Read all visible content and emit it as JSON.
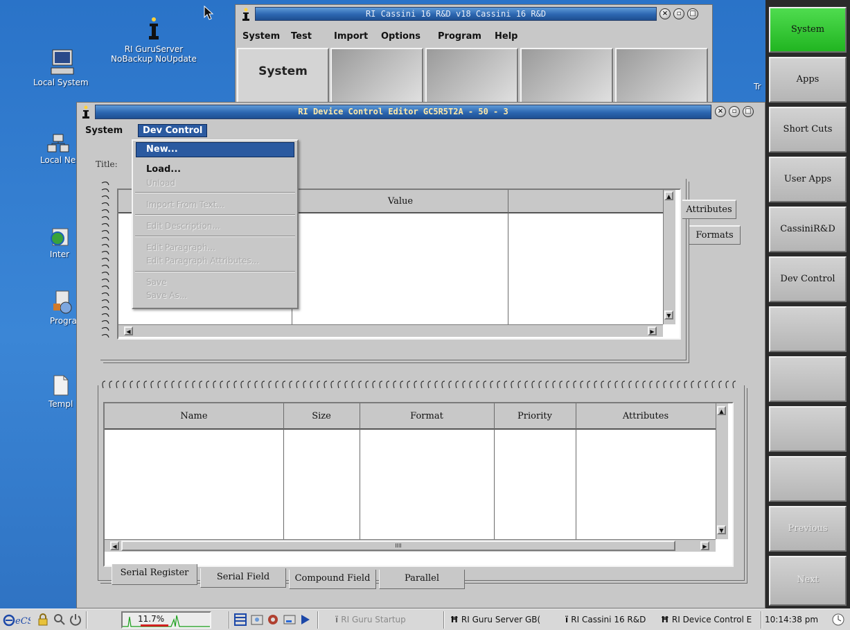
{
  "desktop": {
    "icons": [
      {
        "label": "Local System",
        "icon": "computer-icon"
      },
      {
        "label": "RI GuruServer",
        "label2": "NoBackup NoUpdate",
        "icon": "ri-server-icon"
      },
      {
        "label": "Local Ne",
        "icon": "network-icon"
      },
      {
        "label": "Inter",
        "icon": "internet-icon"
      },
      {
        "label": "Progra",
        "icon": "programs-icon"
      },
      {
        "label": "Templ",
        "icon": "template-icon"
      },
      {
        "label": "Tr",
        "icon": "trash-icon"
      }
    ]
  },
  "cassini_window": {
    "title": "RI Cassini 16 R&D v18  Cassini 16 R&D",
    "menu": [
      "System",
      "Test",
      "Import",
      "Options",
      "Program",
      "Help"
    ],
    "tabs": [
      "System",
      "",
      "",
      "",
      ""
    ]
  },
  "editor_window": {
    "title": "RI Device Control Editor GC5R5T2A - 50 - 3",
    "menu": [
      "System",
      "Dev Control"
    ],
    "title_label": "Title:",
    "upper_table": {
      "columns": [
        "",
        "Value",
        ""
      ],
      "side_tabs": [
        "Attributes",
        "Formats"
      ]
    },
    "lower_table": {
      "columns": [
        "Name",
        "Size",
        "Format",
        "Priority",
        "Attributes"
      ],
      "scroll_grip": "IIII"
    },
    "bottom_tabs": [
      "Serial Register",
      "Serial Field",
      "Compound Field",
      "Parallel"
    ]
  },
  "dev_control_menu": {
    "items": [
      {
        "label": "New...",
        "state": "highlighted"
      },
      {
        "label": "Load...",
        "state": "enabled"
      },
      {
        "label": "Unload",
        "state": "disabled"
      },
      {
        "label": "Import From Text...",
        "state": "disabled"
      },
      {
        "label": "Edit Description...",
        "state": "disabled"
      },
      {
        "label": "Edit Paragraph...",
        "state": "disabled"
      },
      {
        "label": "Edit Paragraph Attributes...",
        "state": "disabled"
      },
      {
        "label": "Save",
        "state": "disabled"
      },
      {
        "label": "Save As...",
        "state": "disabled"
      }
    ]
  },
  "right_panel": {
    "buttons": [
      {
        "label": "System",
        "state": "active"
      },
      {
        "label": "Apps",
        "state": "normal"
      },
      {
        "label": "Short Cuts",
        "state": "normal"
      },
      {
        "label": "User Apps",
        "state": "normal"
      },
      {
        "label": "CassiniR&D",
        "state": "normal"
      },
      {
        "label": "Dev Control",
        "state": "normal"
      },
      {
        "label": "",
        "state": "normal"
      },
      {
        "label": "",
        "state": "normal"
      },
      {
        "label": "",
        "state": "normal"
      },
      {
        "label": "",
        "state": "normal"
      },
      {
        "label": "Previous",
        "state": "disabled"
      },
      {
        "label": "Next",
        "state": "disabled"
      }
    ]
  },
  "taskbar": {
    "cpu": "11.7%",
    "tasks": [
      "RI Guru Startup",
      "RI Guru Server GB(",
      "RI Cassini 16 R&D",
      "RI Device Control E"
    ],
    "clock": "10:14:38 pm"
  },
  "colors": {
    "desktop": "#2d6fc0",
    "titlebar": "#2c66b0",
    "window_bg": "#c8c8c8",
    "active_button": "#21b521",
    "menu_highlight": "#2b5aa0"
  }
}
